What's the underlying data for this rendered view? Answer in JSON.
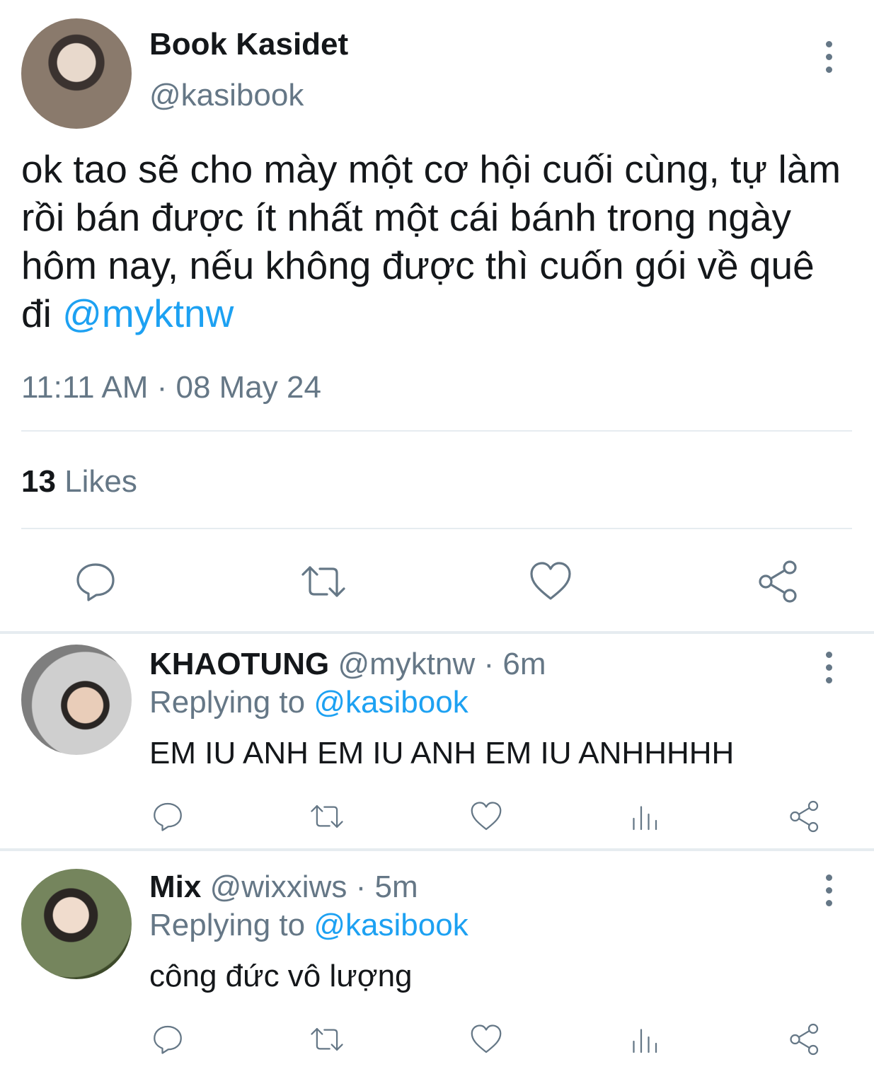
{
  "tweet": {
    "author_name": "Book Kasidet",
    "author_handle": "@kasibook",
    "text_before_mention": "ok tao sẽ cho mày một cơ hội cuối cùng, tự làm rồi bán được ít nhất một cái bánh trong ngày hôm nay, nếu không được thì cuốn gói về quê đi ",
    "mention": "@myktnw",
    "timestamp": "11:11 AM · 08 May 24",
    "likes_count": "13",
    "likes_label": "Likes"
  },
  "replies": [
    {
      "name": "KHAOTUNG",
      "handle": "@myktnw",
      "time": "· 6m",
      "replying_label": "Replying to",
      "replying_to": "@kasibook",
      "text": "EM IU ANH EM IU ANH EM IU ANHHHHH"
    },
    {
      "name": "Mix",
      "handle": "@wixxiws",
      "time": "· 5m",
      "replying_label": "Replying to",
      "replying_to": "@kasibook",
      "text": "công đức vô lượng"
    }
  ],
  "icons": {
    "reply": "reply-icon",
    "retweet": "retweet-icon",
    "like": "heart-icon",
    "analytics": "analytics-icon",
    "share": "share-icon",
    "more": "more-options-icon"
  },
  "colors": {
    "accent": "#1da1f2",
    "muted": "#657786",
    "text": "#14171a",
    "divider": "#e6ecf0"
  }
}
